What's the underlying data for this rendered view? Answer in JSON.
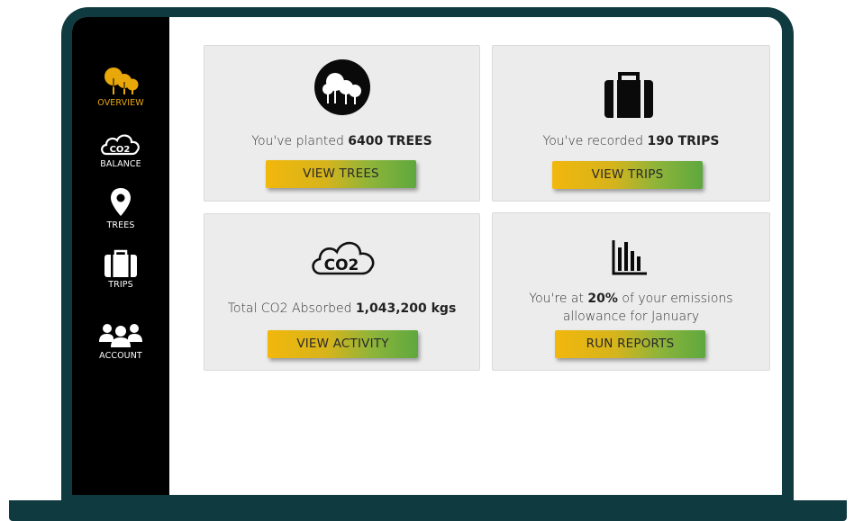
{
  "sidebar": {
    "items": [
      {
        "label": "OVERVIEW",
        "icon": "trees-icon",
        "active": true
      },
      {
        "label": "BALANCE",
        "icon": "co2-cloud-icon",
        "active": false
      },
      {
        "label": "TREES",
        "icon": "location-pin-icon",
        "active": false
      },
      {
        "label": "TRIPS",
        "icon": "suitcase-icon",
        "active": false
      },
      {
        "label": "ACCOUNT",
        "icon": "users-icon",
        "active": false
      }
    ]
  },
  "cards": {
    "trees": {
      "text_prefix": "You've planted ",
      "text_value": "6400 TREES",
      "button": "VIEW TREES",
      "icon": "trees-circle-icon"
    },
    "trips": {
      "text_prefix": "You've recorded ",
      "text_value": "190 TRIPS",
      "button": "VIEW TRIPS",
      "icon": "suitcase-icon"
    },
    "co2": {
      "text_prefix": "Total CO2 Absorbed ",
      "text_value": "1,043,200 kgs",
      "button": "VIEW ACTIVITY",
      "icon": "co2-cloud-icon",
      "icon_text": "CO2"
    },
    "reports": {
      "text_prefix": "You're at ",
      "text_value": "20%",
      "text_suffix": " of your emissions",
      "text_line2": "allowance for January",
      "button": "RUN REPORTS",
      "icon": "bar-chart-icon"
    }
  },
  "colors": {
    "frame": "#0f3a3f",
    "sidebar": "#000000",
    "active": "#e8a80a",
    "card_bg": "#ececec",
    "button_start": "#f2b70c",
    "button_end": "#5ea83e"
  }
}
